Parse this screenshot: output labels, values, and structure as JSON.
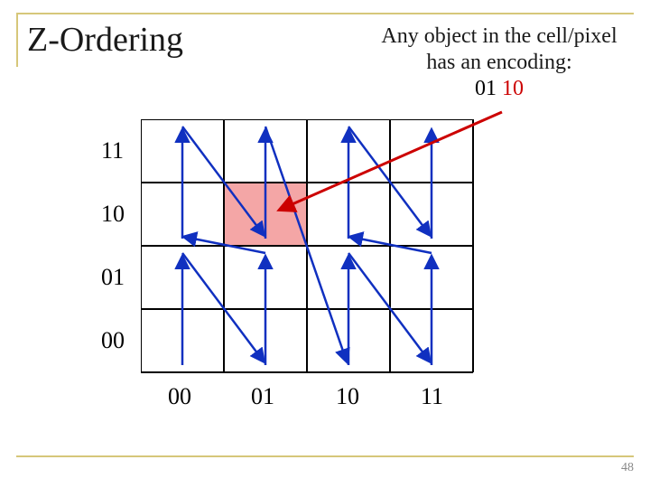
{
  "title": "Z-Ordering",
  "caption_line1": "Any object in the cell/pixel",
  "caption_line2": "has an encoding:",
  "encoding_x": "01",
  "encoding_y": "10",
  "y_labels": [
    "11",
    "10",
    "01",
    "00"
  ],
  "x_labels": [
    "00",
    "01",
    "10",
    "11"
  ],
  "page_number": "48",
  "grid": {
    "cols": 4,
    "rows": 4,
    "highlighted_cell": {
      "col": 1,
      "row_from_top": 1
    }
  },
  "colors": {
    "grid_line": "#000000",
    "highlight_fill": "#f4a6a6",
    "arrow": "#1030c0",
    "callout": "#cc0000",
    "rule": "#d6c77a"
  },
  "chart_data": {
    "type": "table",
    "title": "Z-Ordering 4x4 grid with highlighted cell (x=01, y=10)",
    "x": [
      "00",
      "01",
      "10",
      "11"
    ],
    "y": [
      "00",
      "01",
      "10",
      "11"
    ],
    "highlighted": {
      "x": "01",
      "y": "10",
      "encoding": "01 10"
    }
  }
}
